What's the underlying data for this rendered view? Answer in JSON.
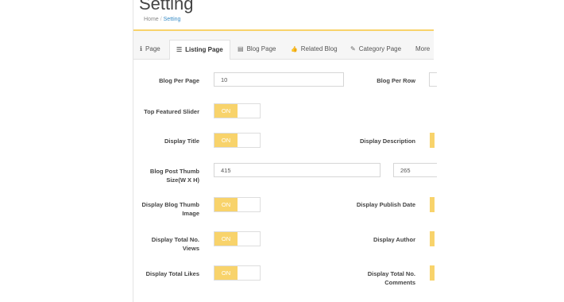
{
  "page": {
    "title": "Setting",
    "breadcrumb": {
      "home": "Home",
      "separator": "/",
      "current": "Setting"
    }
  },
  "tabs": [
    {
      "label": "Page",
      "icon": "info-icon",
      "glyph": "ℹ"
    },
    {
      "label": "Listing Page",
      "icon": "list-icon",
      "glyph": "☰"
    },
    {
      "label": "Blog Page",
      "icon": "card-icon",
      "glyph": "▤"
    },
    {
      "label": "Related Blog",
      "icon": "thumbs-up-icon",
      "glyph": "👍"
    },
    {
      "label": "Category Page",
      "icon": "tag-icon",
      "glyph": "✎"
    },
    {
      "label": "More",
      "icon": "",
      "glyph": ""
    }
  ],
  "form": {
    "blog_per_page": {
      "label": "Blog Per Page",
      "value": "10"
    },
    "blog_per_row": {
      "label": "Blog Per Row"
    },
    "top_featured_slider": {
      "label": "Top Featured Slider",
      "state": "ON"
    },
    "display_title": {
      "label": "Display Title",
      "state": "ON"
    },
    "display_description": {
      "label": "Display Description"
    },
    "thumb_size": {
      "label_line1": "Blog Post Thumb",
      "label_line2": "Size(W X H)",
      "width": "415",
      "height": "265"
    },
    "display_blog_thumb": {
      "label_line1": "Display Blog Thumb",
      "label_line2": "Image",
      "state": "ON"
    },
    "display_publish_date": {
      "label": "Display Publish Date"
    },
    "display_total_views": {
      "label_line1": "Display Total No.",
      "label_line2": "Views",
      "state": "ON"
    },
    "display_author": {
      "label": "Display Author"
    },
    "display_total_likes": {
      "label": "Display Total Likes",
      "state": "ON"
    },
    "display_total_comments": {
      "label_line1": "Display Total No.",
      "label_line2": "Comments"
    }
  },
  "colors": {
    "accent": "#f8d36b",
    "link": "#3a8dc6"
  }
}
